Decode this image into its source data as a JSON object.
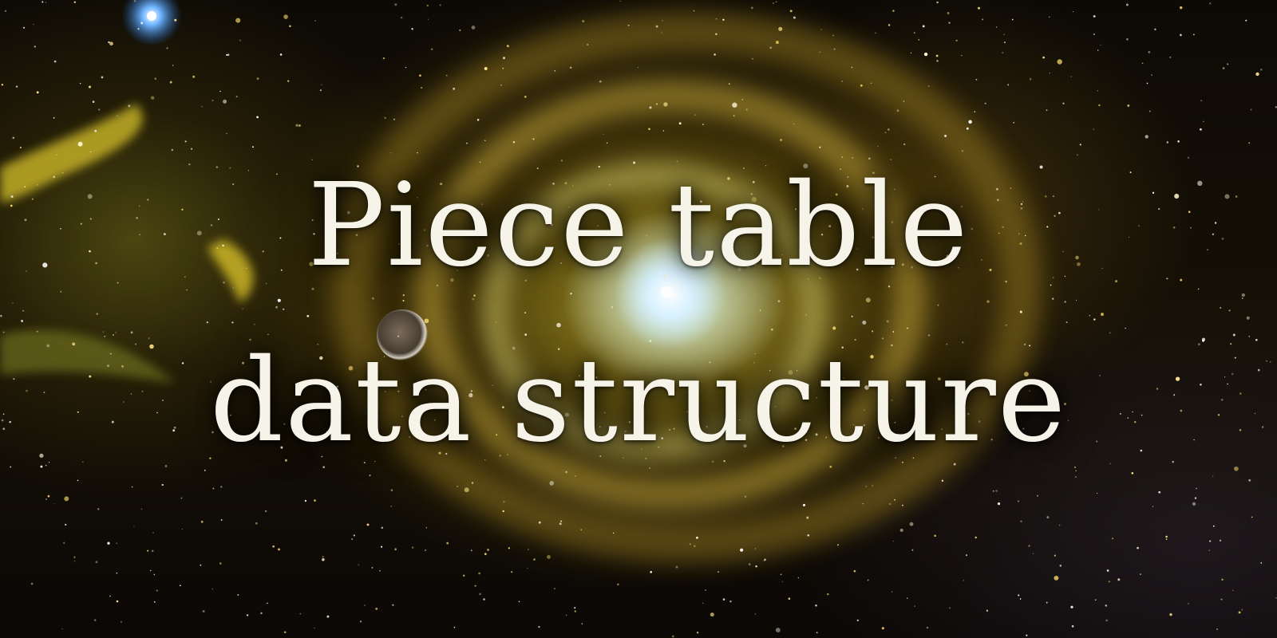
{
  "title": {
    "line1": "Piece table",
    "line2": "data structure"
  },
  "colors": {
    "text": "#f6f3e8",
    "nebula_core": "#e1f0e6",
    "nebula_gold": "#a08c14",
    "space": "#0d0a05"
  }
}
